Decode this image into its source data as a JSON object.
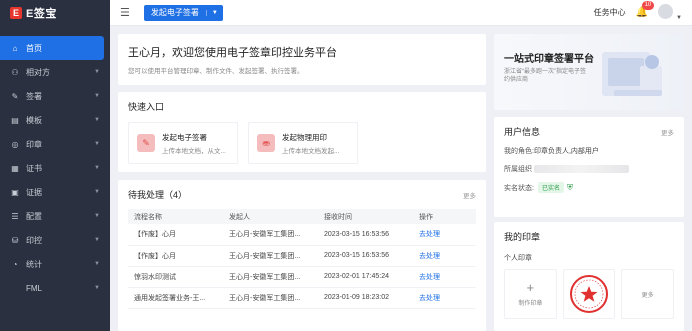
{
  "app": {
    "logo_mark": "E",
    "logo_text": "E签宝"
  },
  "sidebar": {
    "items": [
      {
        "label": "首页",
        "icon": "home-icon",
        "glyph": "⌂"
      },
      {
        "label": "相对方",
        "icon": "counterparty-icon",
        "glyph": "⚇"
      },
      {
        "label": "签署",
        "icon": "sign-icon",
        "glyph": "✎"
      },
      {
        "label": "模板",
        "icon": "template-icon",
        "glyph": "▤"
      },
      {
        "label": "印章",
        "icon": "seal-icon",
        "glyph": "◎"
      },
      {
        "label": "证书",
        "icon": "certificate-icon",
        "glyph": "▦"
      },
      {
        "label": "证据",
        "icon": "evidence-icon",
        "glyph": "▣"
      },
      {
        "label": "配置",
        "icon": "settings-icon",
        "glyph": "☰"
      },
      {
        "label": "印控",
        "icon": "seal-control-icon",
        "glyph": "⛁"
      },
      {
        "label": "统计",
        "icon": "stats-icon",
        "glyph": "◔"
      },
      {
        "label": "FML",
        "icon": "",
        "glyph": ""
      }
    ]
  },
  "topbar": {
    "start_button": "发起电子签署",
    "task_center": "任务中心",
    "badge": "10"
  },
  "welcome": {
    "title": "王心月，欢迎您使用电子签章印控业务平台",
    "subtitle": "您可以使用平台管理印章、制作文件、发起签署、执行签署。"
  },
  "quick": {
    "title": "快速入口",
    "items": [
      {
        "title": "发起电子签署",
        "subtitle": "上传本地文档，从文..."
      },
      {
        "title": "发起物理用印",
        "subtitle": "上传本地文档发起..."
      }
    ]
  },
  "todo": {
    "title": "待我处理（4）",
    "more": "更多",
    "headers": [
      "流程名称",
      "发起人",
      "接收时间",
      "操作"
    ],
    "rows": [
      [
        "【作废】心月",
        "王心月-安徽军工集团...",
        "2023-03-15 16:53:56",
        "去处理"
      ],
      [
        "【作废】心月",
        "王心月-安徽军工集团...",
        "2023-03-15 16:53:56",
        "去处理"
      ],
      [
        "惊羽水印测试",
        "王心月-安徽军工集团...",
        "2023-02-01 17:45:24",
        "去处理"
      ],
      [
        "通用发起签署业务-王...",
        "王心月-安徽军工集团...",
        "2023-01-09 18:23:02",
        "去处理"
      ]
    ]
  },
  "banner": {
    "title": "一站式印章签署平台",
    "subtitle": "浙江省“最多跑一次”指定电子签约供应商"
  },
  "userinfo": {
    "title": "用户信息",
    "more": "更多",
    "role_label": "我的角色:",
    "role_value": "印章负责人,内部用户",
    "org_label": "所属组织",
    "auth_label": "实名状态:",
    "auth_value": "已实名"
  },
  "myseal": {
    "title": "我的印章",
    "subtitle": "个人印章",
    "make_label": "制作印章",
    "more": "更多"
  },
  "colors": {
    "accent": "#1f6fe5",
    "sidebar": "#2b3040",
    "danger": "#e6362d",
    "success": "#2e9c4a"
  }
}
